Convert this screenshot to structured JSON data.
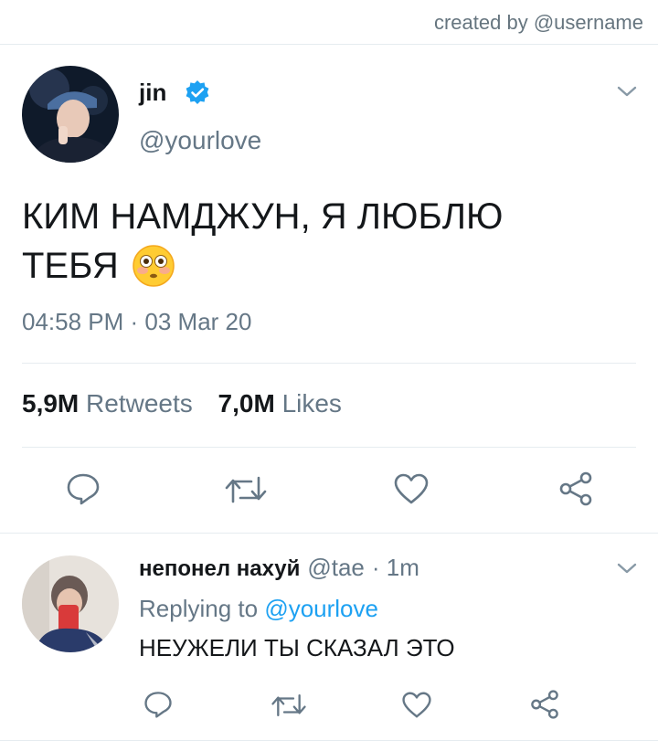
{
  "credit": "created by @username",
  "tweet": {
    "name": "jin",
    "handle": "@yourlove",
    "text_line1": "КИМ НАМДЖУН, Я ЛЮБЛЮ",
    "text_line2": "ТЕБЯ",
    "emoji": "😳",
    "timestamp": "04:58 PM · 03 Mar 20",
    "retweets_count": "5,9M",
    "retweets_label": "Retweets",
    "likes_count": "7,0M",
    "likes_label": "Likes"
  },
  "reply": {
    "name": "непонел нахуй",
    "handle": "@tae",
    "time": "· 1m",
    "replying_prefix": "Replying to",
    "replying_handle": "@yourlove",
    "text": "НЕУЖЕЛИ ТЫ СКАЗАЛ ЭТО"
  },
  "colors": {
    "accent": "#1da1f2",
    "secondary_text": "#657786",
    "divider": "#e6ecf0"
  },
  "icons": [
    "verified-badge-icon",
    "chevron-down-icon",
    "reply-icon",
    "retweet-icon",
    "like-icon",
    "share-icon"
  ]
}
